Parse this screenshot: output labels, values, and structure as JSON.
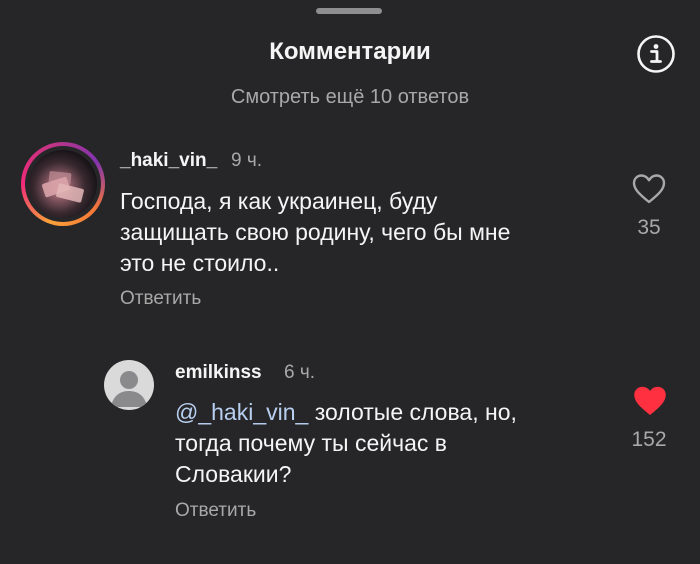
{
  "header": {
    "title": "Комментарии",
    "info_icon": "info-circle-icon"
  },
  "view_more": "Смотреть ещё 10 ответов",
  "comments": [
    {
      "username": "_haki_vin_",
      "time": "9 ч.",
      "text": "Господа, я как украинец, буду\nзащищать свою родину, чего бы мне\nэто не стоило..",
      "reply_label": "Ответить",
      "likes": "35",
      "liked": false,
      "avatar": "story-ring-avatar"
    },
    {
      "username": "emilkinss",
      "time": "6 ч.",
      "mention": "@_haki_vin_",
      "text": " золотые слова, но,\nтогда почему ты  сейчас в\nСловакии?",
      "reply_label": "Ответить",
      "likes": "152",
      "liked": true,
      "avatar": "default-avatar"
    }
  ],
  "colors": {
    "background": "#262628",
    "text": "#f5f5f5",
    "secondary": "#a8a8a8",
    "mention": "#b8cff0",
    "like_active": "#ff3040"
  }
}
